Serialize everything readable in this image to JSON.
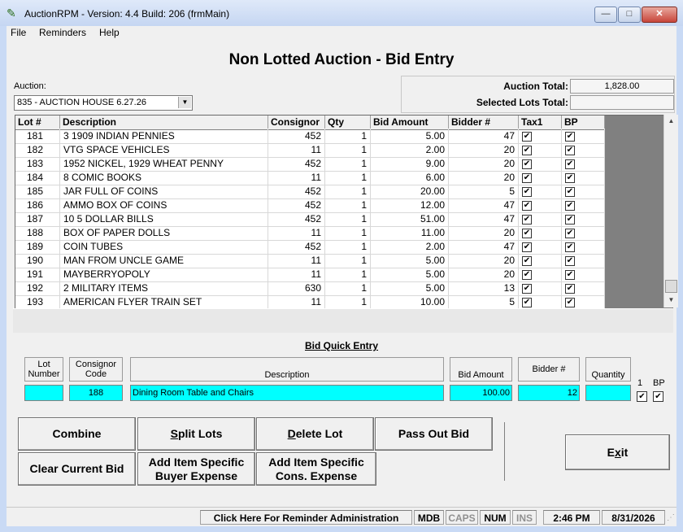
{
  "window": {
    "title": "AuctionRPM - Version: 4.4 Build: 206   (frmMain)",
    "min_glyph": "—",
    "max_glyph": "□",
    "close_glyph": "✕"
  },
  "menu": [
    "File",
    "Reminders",
    "Help"
  ],
  "page_title": "Non Lotted Auction - Bid Entry",
  "auction": {
    "label": "Auction:",
    "selected": "835 - AUCTION HOUSE 6.27.26"
  },
  "totals": {
    "auction_total_label": "Auction Total:",
    "auction_total_value": "1,828.00",
    "selected_lots_label": "Selected Lots Total:",
    "selected_lots_value": ""
  },
  "grid": {
    "columns": [
      "Lot #",
      "Description",
      "Consignor",
      "Qty",
      "Bid Amount",
      "Bidder #",
      "Tax1",
      "BP"
    ],
    "rows": [
      {
        "lot": "181",
        "desc": "3 1909 INDIAN PENNIES",
        "consignor": "452",
        "qty": "1",
        "bid": "5.00",
        "bidder": "47",
        "tax1": true,
        "bp": true
      },
      {
        "lot": "182",
        "desc": "VTG SPACE VEHICLES",
        "consignor": "11",
        "qty": "1",
        "bid": "2.00",
        "bidder": "20",
        "tax1": true,
        "bp": true
      },
      {
        "lot": "183",
        "desc": "1952 NICKEL, 1929 WHEAT PENNY",
        "consignor": "452",
        "qty": "1",
        "bid": "9.00",
        "bidder": "20",
        "tax1": true,
        "bp": true
      },
      {
        "lot": "184",
        "desc": "8 COMIC BOOKS",
        "consignor": "11",
        "qty": "1",
        "bid": "6.00",
        "bidder": "20",
        "tax1": true,
        "bp": true
      },
      {
        "lot": "185",
        "desc": "JAR FULL OF COINS",
        "consignor": "452",
        "qty": "1",
        "bid": "20.00",
        "bidder": "5",
        "tax1": true,
        "bp": true
      },
      {
        "lot": "186",
        "desc": "AMMO BOX OF COINS",
        "consignor": "452",
        "qty": "1",
        "bid": "12.00",
        "bidder": "47",
        "tax1": true,
        "bp": true
      },
      {
        "lot": "187",
        "desc": "10 5 DOLLAR BILLS",
        "consignor": "452",
        "qty": "1",
        "bid": "51.00",
        "bidder": "47",
        "tax1": true,
        "bp": true
      },
      {
        "lot": "188",
        "desc": "BOX OF PAPER DOLLS",
        "consignor": "11",
        "qty": "1",
        "bid": "11.00",
        "bidder": "20",
        "tax1": true,
        "bp": true
      },
      {
        "lot": "189",
        "desc": "COIN TUBES",
        "consignor": "452",
        "qty": "1",
        "bid": "2.00",
        "bidder": "47",
        "tax1": true,
        "bp": true
      },
      {
        "lot": "190",
        "desc": "MAN FROM UNCLE GAME",
        "consignor": "11",
        "qty": "1",
        "bid": "5.00",
        "bidder": "20",
        "tax1": true,
        "bp": true
      },
      {
        "lot": "191",
        "desc": "MAYBERRYOPOLY",
        "consignor": "11",
        "qty": "1",
        "bid": "5.00",
        "bidder": "20",
        "tax1": true,
        "bp": true
      },
      {
        "lot": "192",
        "desc": "2 MILITARY ITEMS",
        "consignor": "630",
        "qty": "1",
        "bid": "5.00",
        "bidder": "13",
        "tax1": true,
        "bp": true
      },
      {
        "lot": "193",
        "desc": "AMERICAN FLYER TRAIN SET",
        "consignor": "11",
        "qty": "1",
        "bid": "10.00",
        "bidder": "5",
        "tax1": true,
        "bp": true
      }
    ],
    "check_glyph": "✔",
    "scroll_up": "▲",
    "scroll_down": "▼"
  },
  "quick_entry": {
    "title": "Bid Quick Entry",
    "lot_label": "Lot Number",
    "consignor_label": "Consignor Code",
    "description_label": "Description",
    "bid_label": "Bid Amount",
    "bidder_label": "Bidder #",
    "quantity_label": "Quantity",
    "tax_label": "1",
    "bp_label": "BP",
    "lot_value": "",
    "consignor_value": "188",
    "description_value": "Dining Room Table and Chairs",
    "bid_value": "100.00",
    "bidder_value": "12",
    "quantity_value": ""
  },
  "buttons": {
    "combine": "Combine",
    "split_lots": "Split Lots",
    "delete_lot": "Delete Lot",
    "pass_out_bid": "Pass Out Bid",
    "clear_current_bid": "Clear Current Bid",
    "add_buyer_expense_1": "Add Item Specific",
    "add_buyer_expense_2": "Buyer Expense",
    "add_cons_expense_1": "Add Item Specific",
    "add_cons_expense_2": "Cons. Expense",
    "exit": "Exit"
  },
  "statusbar": {
    "reminder": "Click Here For Reminder Administration",
    "mdb": "MDB",
    "caps": "CAPS",
    "num": "NUM",
    "ins": "INS",
    "time": "2:46 PM",
    "date": "8/31/2026"
  }
}
